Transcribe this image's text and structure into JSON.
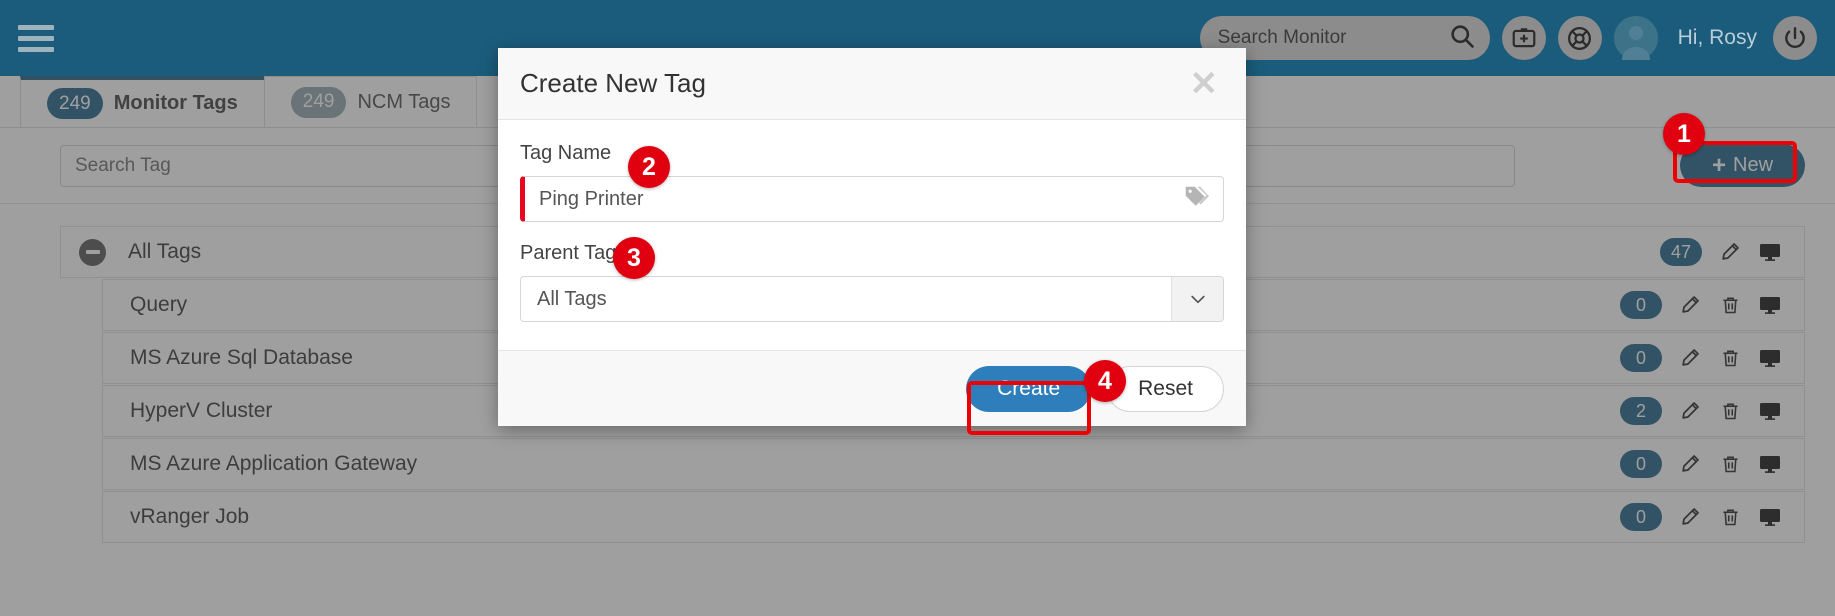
{
  "header": {
    "menu_icon": "hamburger-icon",
    "search_placeholder": "Search Monitor",
    "search_icon": "search-icon",
    "help_kit_icon": "first-aid-kit-icon",
    "support_icon": "life-ring-icon",
    "avatar_icon": "user-avatar-icon",
    "greeting": "Hi, Rosy",
    "power_icon": "power-icon"
  },
  "tabs": [
    {
      "count": "249",
      "label": "Monitor Tags",
      "active": true
    },
    {
      "count": "249",
      "label": "NCM Tags",
      "active": false
    }
  ],
  "toolbar": {
    "search_placeholder": "Search Tag",
    "new_button_label": "New",
    "new_button_plus": "+"
  },
  "tag_tree": {
    "root": {
      "label": "All Tags",
      "count": "47",
      "collapse_icon": "minus-circle-icon",
      "edit_icon": "pencil-icon",
      "monitor_icon": "monitor-icon"
    },
    "children": [
      {
        "label": "Query",
        "count": "0"
      },
      {
        "label": "MS Azure Sql Database",
        "count": "0"
      },
      {
        "label": "HyperV Cluster",
        "count": "2"
      },
      {
        "label": "MS Azure Application Gateway",
        "count": "0"
      },
      {
        "label": "vRanger Job",
        "count": "0"
      }
    ],
    "row_icons": {
      "edit_icon": "pencil-icon",
      "delete_icon": "trash-icon",
      "monitor_icon": "monitor-icon"
    }
  },
  "modal": {
    "title": "Create New Tag",
    "close_icon": "close-icon",
    "tag_name_label": "Tag Name",
    "tag_name_value": "Ping Printer",
    "tag_name_icon": "tag-icon",
    "parent_tag_label": "Parent Tag",
    "parent_tag_value": "All Tags",
    "parent_tag_caret": "chevron-down-icon",
    "create_label": "Create",
    "reset_label": "Reset"
  },
  "annotations": [
    {
      "num": "1"
    },
    {
      "num": "2"
    },
    {
      "num": "3"
    },
    {
      "num": "4"
    }
  ],
  "colors": {
    "header_bg": "#1b5c7c",
    "accent_blue": "#1d6087",
    "primary_button": "#2d7ebb",
    "annotation_red": "#e0000f",
    "error_border": "#e8071f"
  }
}
